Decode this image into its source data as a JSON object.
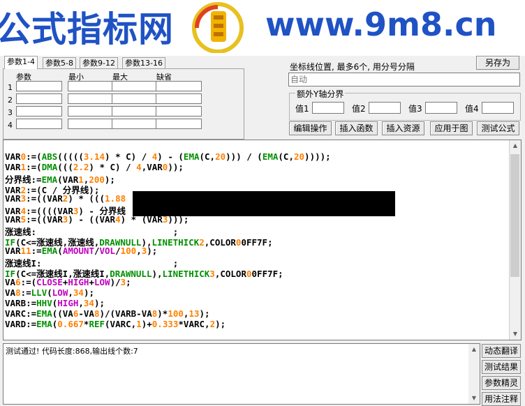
{
  "banner": {
    "title": "公式指标网",
    "url": "www.9m8.cn"
  },
  "tabs": [
    "参数1-4",
    "参数5-8",
    "参数9-12",
    "参数13-16"
  ],
  "param_table": {
    "headers": [
      "参数",
      "最小",
      "最大",
      "缺省"
    ],
    "rows": [
      "1",
      "2",
      "3",
      "4"
    ]
  },
  "axis": {
    "label": "坐标线位置, 最多6个, 用分号分隔",
    "save_as": "另存为",
    "value": "自动"
  },
  "extra_axis": {
    "title": "额外Y轴分界",
    "values": [
      "值1",
      "值2",
      "值3",
      "值4"
    ]
  },
  "toolbar": [
    "编辑操作",
    "插入函数",
    "插入资源",
    "应用于图",
    "测试公式"
  ],
  "code": {
    "lines": [
      "VAR0:=(ABS(((((3.14) * C) / 4) - (EMA(C,20))) / (EMA(C,20))));",
      "VAR1:=(DMA(((2.2) * C) / 4,VAR0));",
      "分界线:=EMA(VAR1,200);",
      "VAR2:=(C / 分界线);",
      "VAR3:=((VAR2) * (((1.88",
      "VAR4:=((((VAR3) - 分界线",
      "VAR5:=((VAR3) - ((VAR4) * (VAR3)));",
      "涨速线:                          ;",
      "IF(C<=涨速线,涨速线,DRAWNULL),LINETHICK2,COLOR00FF7F;",
      "VAR11:=EMA(AMOUNT/VOL/100,3);",
      "涨速线I:                         ;",
      "IF(C<=涨速线I,涨速线I,DRAWNULL),LINETHICK3,COLOR00FF7F;",
      "VA6:=(CLOSE+HIGH+LOW)/3;",
      "VA8:=LLV(LOW,34);",
      "VARB:=HHV(HIGH,34);",
      "VARC:=EMA((VA6-VA8)/(VARB-VA8)*100,13);",
      "VARD:=EMA(0.667*REF(VARC,1)+0.333*VARC,2);"
    ]
  },
  "output": {
    "message": "测试通过! 代码长度:868,输出线个数:7"
  },
  "side_buttons": [
    "动态翻译",
    "测试结果",
    "参数精灵",
    "用法注释"
  ]
}
